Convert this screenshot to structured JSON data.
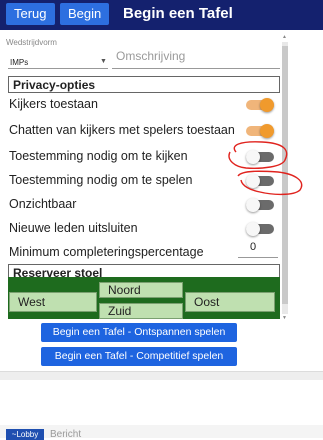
{
  "header": {
    "back_label": "Terug",
    "begin_label": "Begin",
    "title": "Begin een Tafel"
  },
  "form": {
    "wedstrijdvorm_label": "Wedstrijdvorm",
    "wedstrijdvorm_value": "IMPs",
    "omschrijving_placeholder": "Omschrijving"
  },
  "privacy": {
    "title": "Privacy-opties",
    "options": [
      {
        "label": "Kijkers toestaan",
        "on": true
      },
      {
        "label": "Chatten van kijkers met spelers toestaan",
        "on": true
      },
      {
        "label": "Toestemming nodig om te kijken",
        "on": false
      },
      {
        "label": "Toestemming nodig om te spelen",
        "on": false
      },
      {
        "label": "Onzichtbaar",
        "on": false
      },
      {
        "label": "Nieuwe leden uitsluiten",
        "on": false
      }
    ],
    "min_completion_label": "Minimum completeringspercentage",
    "min_completion_value": "0"
  },
  "seats": {
    "title": "Reserveer stoel",
    "north": "Noord",
    "west": "West",
    "east": "Oost",
    "south": "Zuid"
  },
  "actions": {
    "relax_label": "Begin een Tafel - Ontspannen spelen",
    "competitive_label": "Begin een Tafel - Competitief spelen"
  },
  "bottom": {
    "lobby_label": "~Lobby",
    "message_placeholder": "Bericht"
  },
  "colors": {
    "header_bg": "#14216e",
    "button_blue": "#1e64e0",
    "toggle_on": "#f09a2d",
    "seat_green": "#1e6b1e",
    "annotation_red": "#e0231e"
  }
}
